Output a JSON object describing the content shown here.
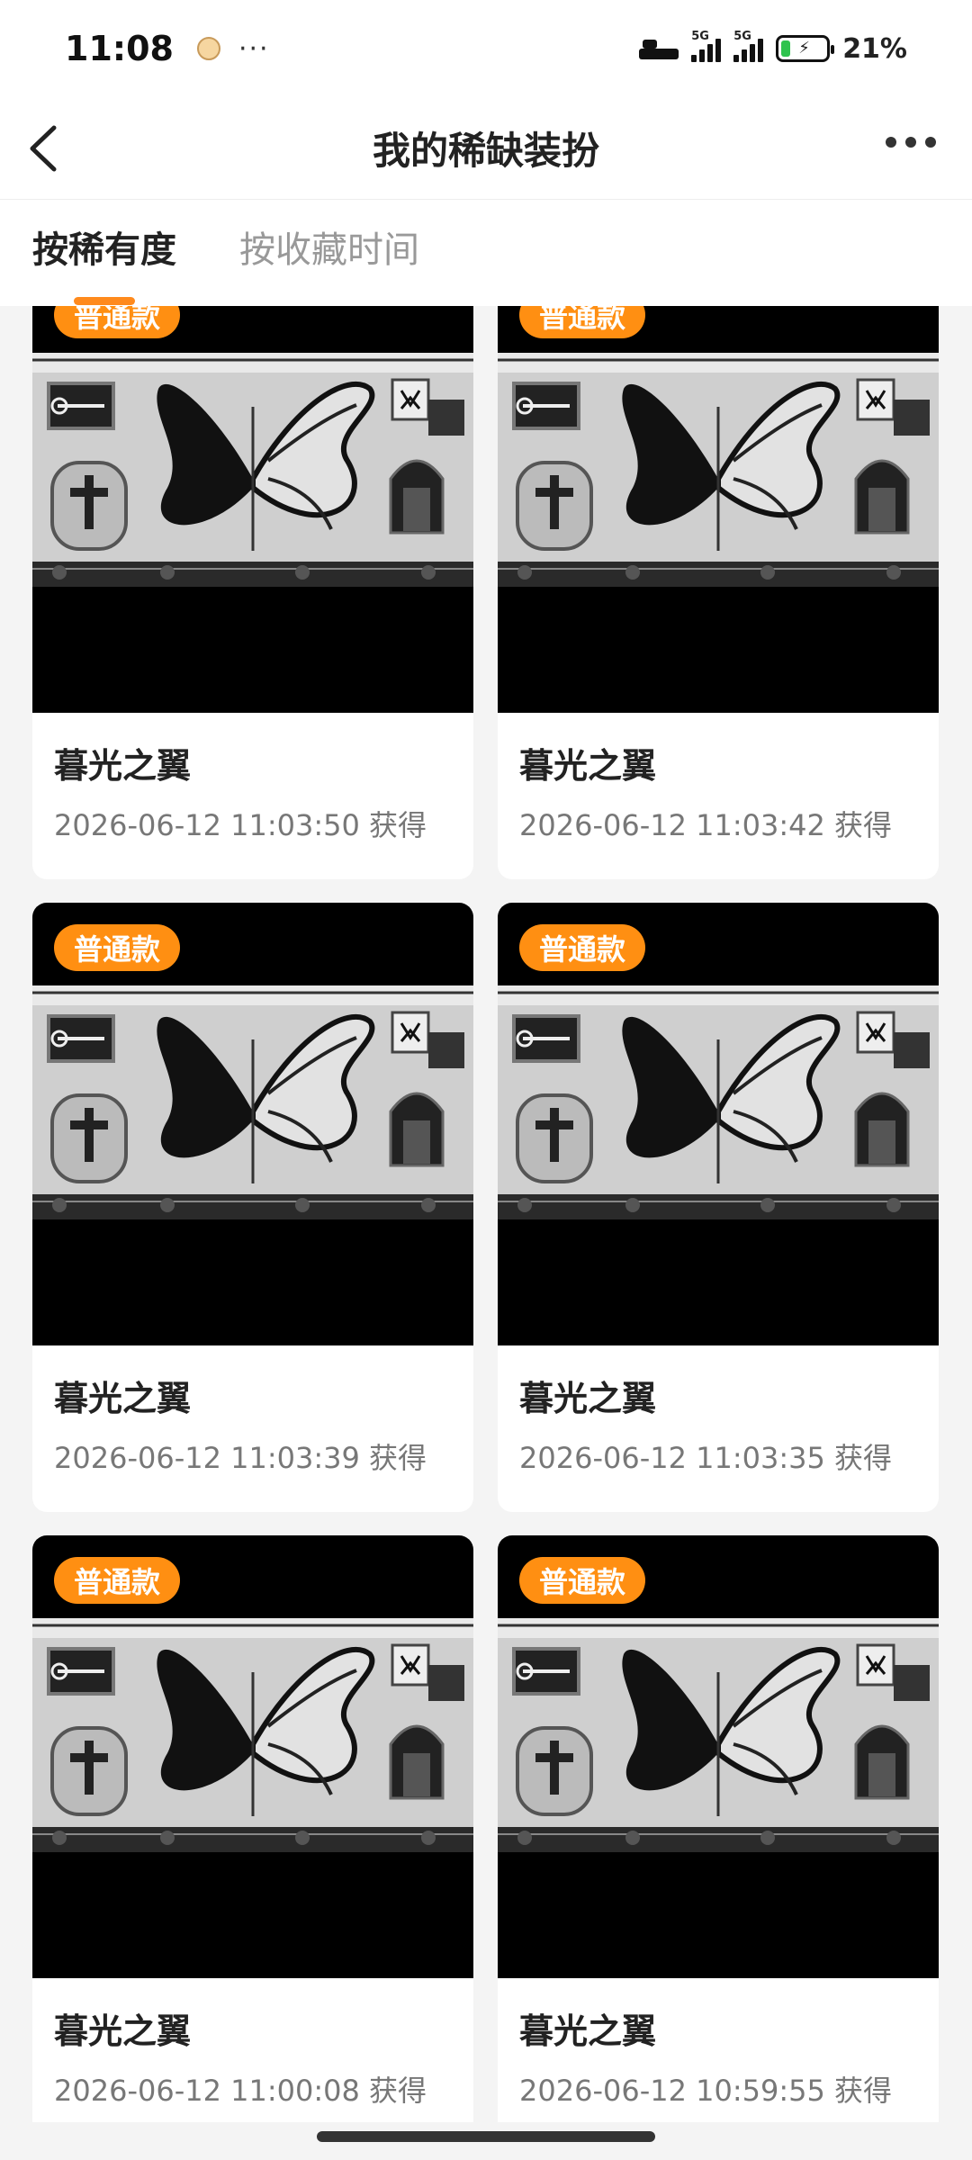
{
  "status_bar": {
    "time": "11:08",
    "more_glyph": "···",
    "network_1": "5G",
    "network_2": "5G",
    "battery_percent": "21%",
    "battery_color": "#2fc34e"
  },
  "nav": {
    "title": "我的稀缺装扮",
    "back_icon": "chevron-left-icon",
    "more_icon": "more-horizontal-icon"
  },
  "tabs": [
    {
      "label": "按稀有度",
      "active": true
    },
    {
      "label": "按收藏时间",
      "active": false
    }
  ],
  "accent_color": "#ff8a1d",
  "items": [
    {
      "badge": "普通款",
      "title": "暮光之翼",
      "time": "2026-06-12 11:03:50 获得"
    },
    {
      "badge": "普通款",
      "title": "暮光之翼",
      "time": "2026-06-12 11:03:42 获得"
    },
    {
      "badge": "普通款",
      "title": "暮光之翼",
      "time": "2026-06-12 11:03:39 获得"
    },
    {
      "badge": "普通款",
      "title": "暮光之翼",
      "time": "2026-06-12 11:03:35 获得"
    },
    {
      "badge": "普通款",
      "title": "暮光之翼",
      "time": "2026-06-12 11:00:08 获得"
    },
    {
      "badge": "普通款",
      "title": "暮光之翼",
      "time": "2026-06-12 10:59:55 获得"
    }
  ]
}
